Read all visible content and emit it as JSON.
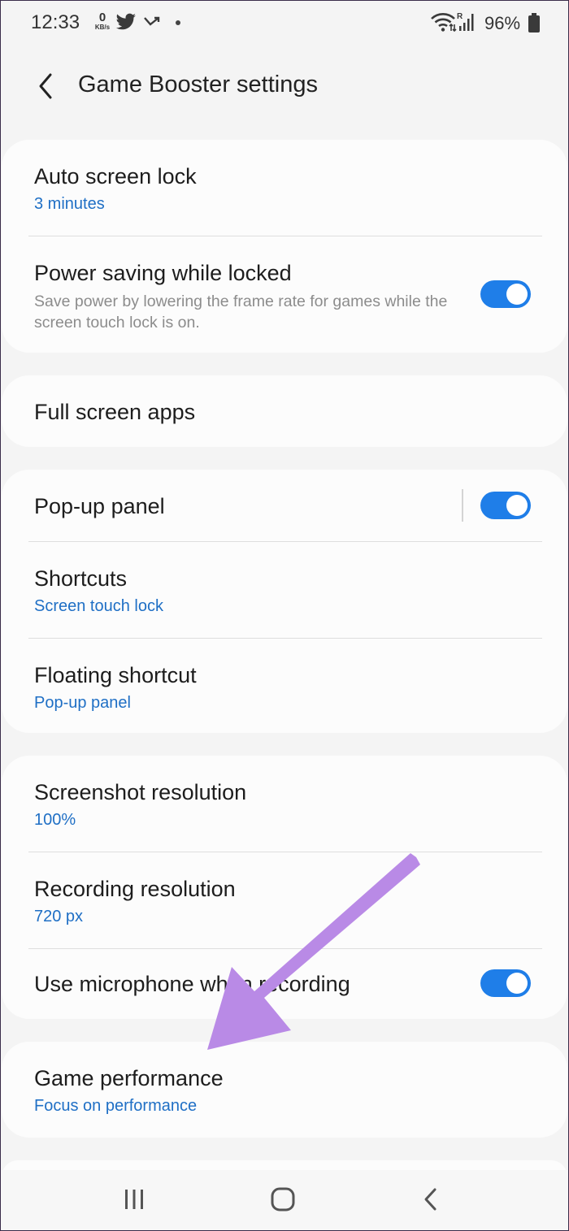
{
  "status_bar": {
    "time": "12:33",
    "kb_value": "0",
    "kb_unit": "KB/s",
    "battery_percent": "96%",
    "icons": [
      "twitter-icon",
      "missed-call-icon",
      "dot-icon",
      "wifi-icon",
      "signal-icon",
      "battery-icon"
    ]
  },
  "header": {
    "title": "Game Booster settings",
    "back_icon": "back-arrow-icon"
  },
  "groups": {
    "g1": {
      "auto_lock_title": "Auto screen lock",
      "auto_lock_value": "3 minutes",
      "power_title": "Power saving while locked",
      "power_desc": "Save power by lowering the frame rate for games while the screen touch lock is on.",
      "power_toggle_on": true
    },
    "g2": {
      "full_screen_title": "Full screen apps"
    },
    "g3": {
      "popup_title": "Pop-up panel",
      "popup_toggle_on": true,
      "shortcuts_title": "Shortcuts",
      "shortcuts_value": "Screen touch lock",
      "floating_title": "Floating shortcut",
      "floating_value": "Pop-up panel"
    },
    "g4": {
      "screenshot_title": "Screenshot resolution",
      "screenshot_value": "100%",
      "recording_title": "Recording resolution",
      "recording_value": "720 px",
      "mic_title": "Use microphone when recording",
      "mic_toggle_on": true
    },
    "g5": {
      "performance_title": "Game performance",
      "performance_value": "Focus on performance"
    }
  },
  "nav_bar": {
    "icons": [
      "recent-apps-icon",
      "home-icon",
      "back-icon"
    ]
  },
  "colors": {
    "accent": "#1f7ee8",
    "link_blue": "#1f6fc5",
    "annotation_arrow": "#b98ae6",
    "background": "#f4f4f4",
    "card": "#fcfcfc"
  }
}
